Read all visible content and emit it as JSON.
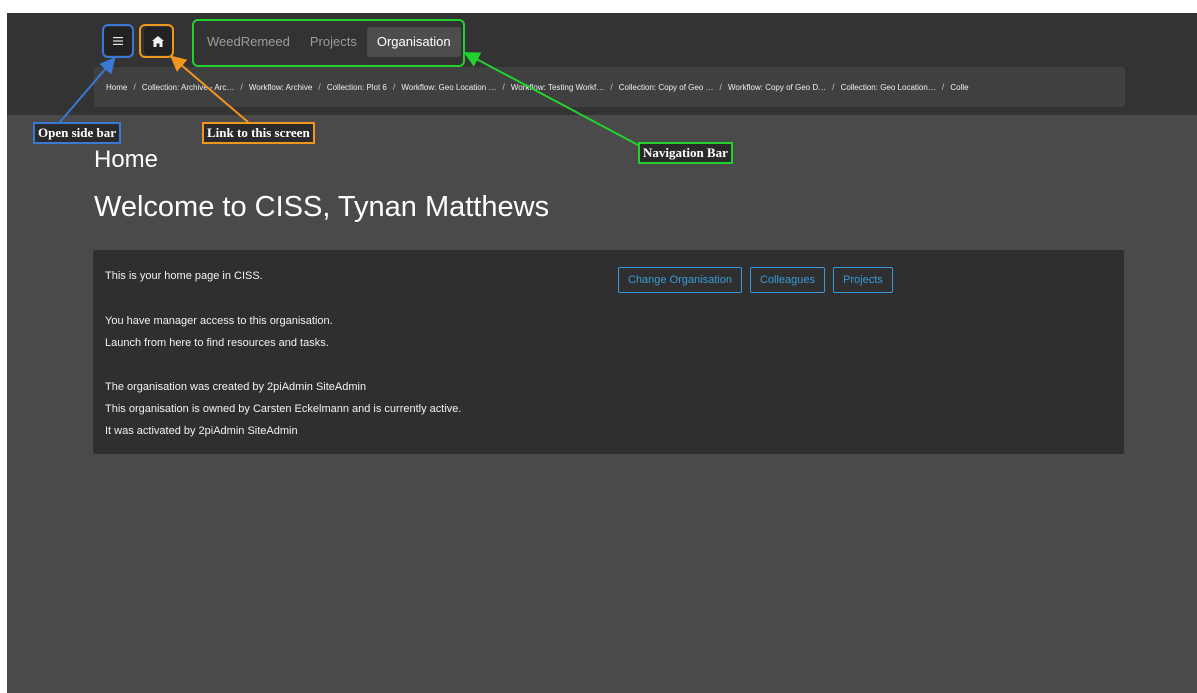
{
  "header": {
    "menu_icon": "hamburger-menu-icon",
    "home_icon": "home-icon",
    "tabs": [
      {
        "label": "WeedRemeed",
        "active": false
      },
      {
        "label": "Projects",
        "active": false
      },
      {
        "label": "Organisation",
        "active": true
      }
    ]
  },
  "breadcrumb": [
    "Home",
    "Collection: Archive - Arc…",
    "Workflow: Archive",
    "Collection: Plot 6",
    "Workflow: Geo Location …",
    "Workflow: Testing Workf…",
    "Collection: Copy of Geo …",
    "Workflow: Copy of Geo D…",
    "Collection: Geo Location…",
    "Colle"
  ],
  "page": {
    "title": "Home",
    "welcome": "Welcome to CISS, Tynan Matthews"
  },
  "panel": {
    "intro": "This is your home page in CISS.",
    "access": "You have manager access to this organisation.",
    "launch": "Launch from here to find resources and tasks.",
    "created_by": "The organisation was created by 2piAdmin SiteAdmin",
    "owned_by": "This organisation is owned by Carsten Eckelmann and is currently active.",
    "activated_by": "It was activated by 2piAdmin SiteAdmin",
    "buttons": {
      "change_org": "Change Organisation",
      "colleagues": "Colleagues",
      "projects": "Projects"
    }
  },
  "annotations": {
    "open_side_bar": "Open side bar",
    "link_to_screen": "Link to this screen",
    "navigation_bar": "Navigation Bar"
  },
  "colors": {
    "annotation_blue": "#3a78d6",
    "annotation_orange": "#f0961e",
    "annotation_green": "#22d12e",
    "button_accent": "#3a9ad9"
  }
}
